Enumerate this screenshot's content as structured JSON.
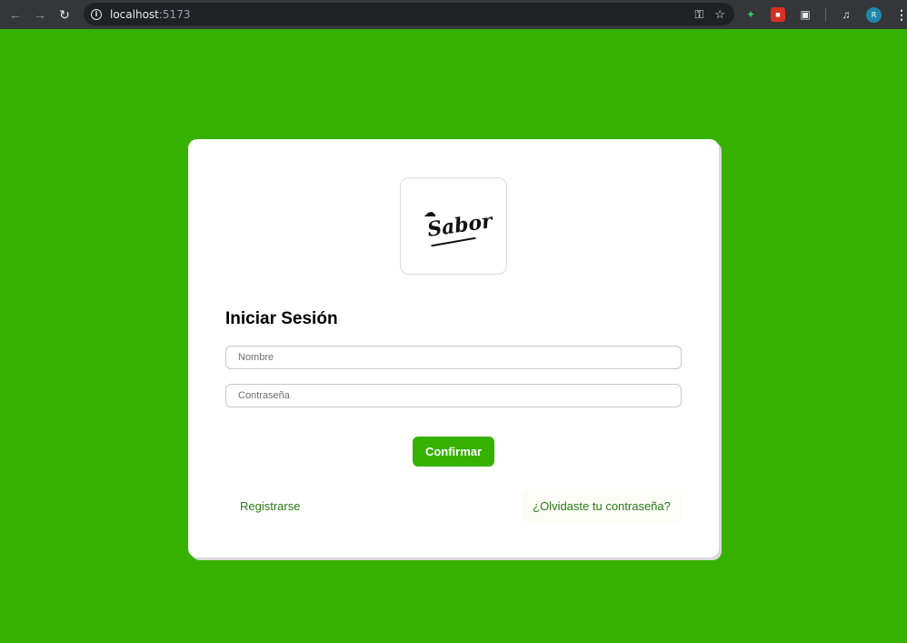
{
  "browser": {
    "url_host": "localhost",
    "url_port": ":5173",
    "back_icon": "arrow-left-icon",
    "forward_icon": "arrow-right-icon",
    "reload_icon": "reload-icon",
    "avatar_initial": "R"
  },
  "login": {
    "logo_text": "Sabor",
    "title": "Iniciar Sesión",
    "name_placeholder": "Nombre",
    "password_placeholder": "Contraseña",
    "confirm_label": "Confirmar",
    "register_label": "Registrarse",
    "forgot_label": "¿Olvidaste tu contraseña?"
  },
  "colors": {
    "background": "#37b100",
    "button": "#37b100",
    "link": "#2a7a14",
    "card": "#ffffff"
  }
}
